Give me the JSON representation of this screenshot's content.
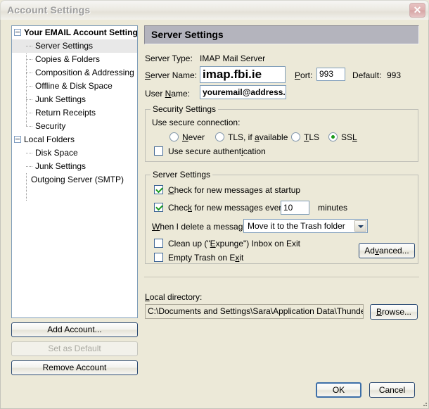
{
  "window": {
    "title": "Account Settings",
    "close_label": "✕"
  },
  "tree": {
    "items": [
      {
        "label": "Your EMAIL Account Settings",
        "level": 0,
        "expanded": true,
        "selected": false
      },
      {
        "label": "Server Settings",
        "level": 1,
        "selected": true
      },
      {
        "label": "Copies & Folders",
        "level": 1,
        "selected": false
      },
      {
        "label": "Composition & Addressing",
        "level": 1,
        "selected": false
      },
      {
        "label": "Offline & Disk Space",
        "level": 1,
        "selected": false
      },
      {
        "label": "Junk Settings",
        "level": 1,
        "selected": false
      },
      {
        "label": "Return Receipts",
        "level": 1,
        "selected": false
      },
      {
        "label": "Security",
        "level": 1,
        "selected": false
      },
      {
        "label": "Local Folders",
        "level": 0,
        "expanded": true,
        "selected": false
      },
      {
        "label": "Disk Space",
        "level": 1,
        "selected": false
      },
      {
        "label": "Junk Settings",
        "level": 1,
        "selected": false
      },
      {
        "label": "Outgoing Server (SMTP)",
        "level": 1,
        "selected": false
      }
    ]
  },
  "account_buttons": {
    "add": "Add Account...",
    "set_default": "Set as Default",
    "remove": "Remove Account"
  },
  "panel": {
    "header": "Server Settings",
    "server_type_label": "Server Type:",
    "server_type_value": "IMAP Mail Server",
    "server_name_label": "Server Name:",
    "server_name_value": "imap.fbi.ie",
    "port_label": "Port:",
    "port_value": "993",
    "default_label": "Default:",
    "default_value": "993",
    "user_name_label": "User Name:",
    "user_name_value": "youremail@address.ie"
  },
  "security": {
    "group_title": "Security Settings",
    "connection_label": "Use secure connection:",
    "options": [
      {
        "label": "Never",
        "selected": false
      },
      {
        "label": "TLS, if available",
        "selected": false
      },
      {
        "label": "TLS",
        "selected": false
      },
      {
        "label": "SSL",
        "selected": true
      }
    ],
    "secure_auth_label": "Use secure authentication",
    "secure_auth_checked": false
  },
  "server_settings": {
    "group_title": "Server Settings",
    "check_startup_label": "Check for new messages at startup",
    "check_startup_checked": true,
    "check_every_label": "Check for new messages every",
    "check_every_checked": true,
    "check_every_value": "10",
    "minutes_label": "minutes",
    "delete_label": "When I delete a message:",
    "delete_value": "Move it to the Trash folder",
    "expunge_label": "Clean up (\"Expunge\") Inbox on Exit",
    "expunge_checked": false,
    "empty_trash_label": "Empty Trash on Exit",
    "empty_trash_checked": false,
    "advanced_label": "Advanced..."
  },
  "local_directory": {
    "label": "Local directory:",
    "value": "C:\\Documents and Settings\\Sara\\Application Data\\Thunderbird\\l",
    "browse_label": "Browse..."
  },
  "dialog_buttons": {
    "ok": "OK",
    "cancel": "Cancel"
  },
  "colors": {
    "dialog_bg": "#ece9d8",
    "panel_header_bg": "#b4b4bd",
    "accent_green": "#17991e",
    "focus_blue": "#3d6fa8"
  }
}
